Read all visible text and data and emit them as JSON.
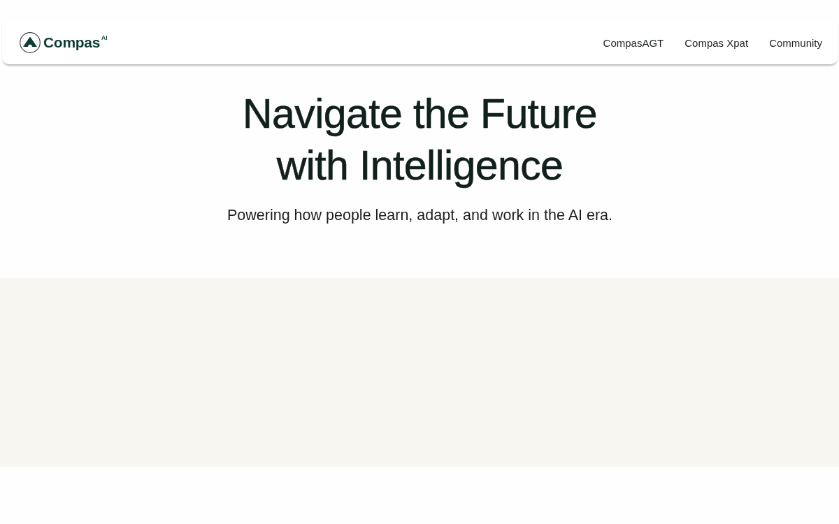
{
  "header": {
    "logo": {
      "name": "Compas",
      "suffix": "AI"
    },
    "nav": [
      {
        "label": "CompasAGT"
      },
      {
        "label": "Compas Xpat"
      },
      {
        "label": "Community"
      }
    ]
  },
  "hero": {
    "title": "Navigate the Future with Intelligence",
    "subtitle": "Powering how people learn, adapt, and work in the AI era."
  }
}
